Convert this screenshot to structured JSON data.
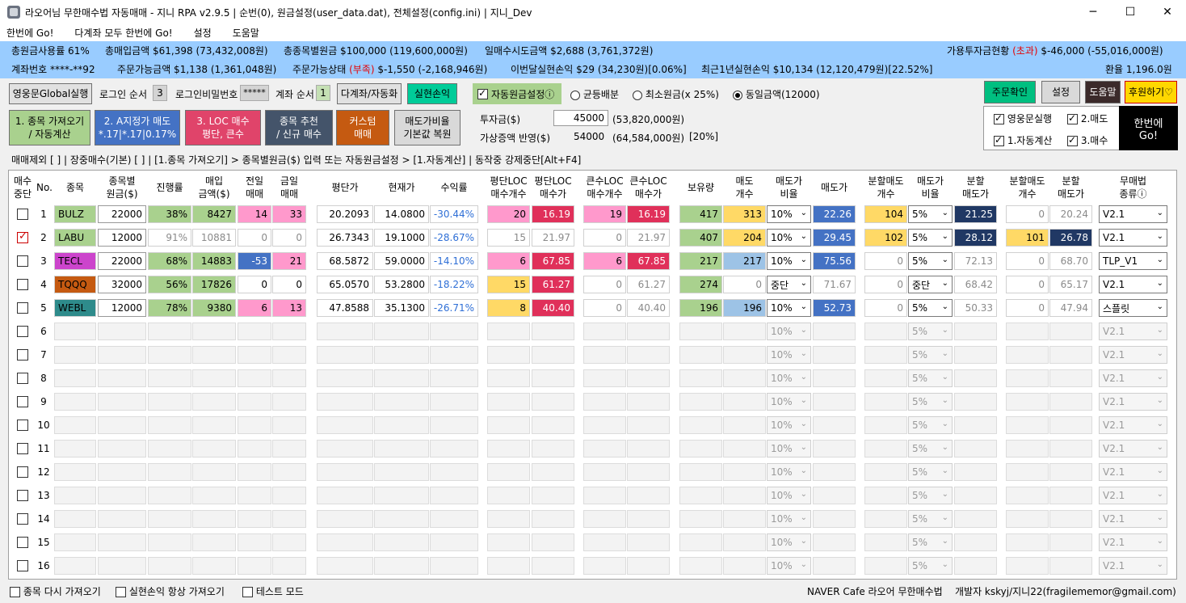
{
  "title": "라오어님 무한매수법 자동매매 - 지니 RPA v2.9.5    | 순번(0),  원금설정(user_data.dat),  전체설정(config.ini) | 지니_Dev",
  "window": {
    "minimize": "─",
    "maximize": "☐",
    "close": "✕"
  },
  "menu": [
    "한번에 Go!",
    "다계좌 모두 한번에 Go!",
    "설정",
    "도움말"
  ],
  "info1": {
    "a": "총원금사용률 61%",
    "b": "총매입금액 $61,398 (73,432,008원)",
    "c": "총종목별원금 $100,000 (119,600,000원)",
    "d": "일매수시도금액 $2,688 (3,761,372원)",
    "e1": "가용투자금현황 ",
    "e2": "(초과)",
    "e3": " $-46,000 (-55,016,000원)"
  },
  "info2": {
    "a": "계좌번호 ****-**92",
    "b": "주문가능금액 $1,138 (1,361,048원)",
    "c1": "주문가능상태 ",
    "c2": "(부족)",
    "c3": " $-1,550 (-2,168,946원)",
    "d": "이번달실현손익 $29 (34,230원)[0.06%]",
    "e": "최근1년실현손익 $10,134 (12,120,479원)[22.52%]",
    "f": "환율 1,196.0원"
  },
  "controls": {
    "global_btn": "영웅문Global실행",
    "login_order_label": "로그인 순서",
    "login_order": "3",
    "login_pw_label": "로그인비밀번호",
    "login_pw": "*****",
    "acct_order_label": "계좌 순서",
    "acct_order": "1",
    "multi_btn": "다계좌/자동화",
    "realized_btn": "실현손익",
    "auto_principal": "자동원금설정ⓘ",
    "opt1": "균등배분",
    "opt2": "최소원금(x 25%)",
    "opt3": "동일금액(12000)",
    "order_check": "주문확인",
    "settings": "설정",
    "help": "도움말",
    "donate": "후원하기♡"
  },
  "actions": {
    "b1a": "1. 종목 가져오기",
    "b1b": "/ 자동계산",
    "b2a": "2. A지정가 매도",
    "b2b": "*.17|*.17|0.17%",
    "b3a": "3. LOC 매수",
    "b3b": "평단, 큰수",
    "b4a": "종목 추천",
    "b4b": "/ 신규 매수",
    "b5a": "커스텀",
    "b5b": "매매",
    "b6a": "매도가비율",
    "b6b": "기본값 복원"
  },
  "invest": {
    "label1": "투자금($)",
    "value1": "45000",
    "won1": "(53,820,000원)",
    "label2": "가상증액 반영($)",
    "value2": "54000",
    "won2": "(64,584,000원)",
    "pct": "[20%]"
  },
  "go": {
    "c1": "영웅문실행",
    "c2": "2.매도",
    "c3": "1.자동계산",
    "c4": "3.매수",
    "go1": "한번에",
    "go2": "Go!"
  },
  "status": "매매제외 [  ] | 장중매수(기본) [  ] | [1.종목 가져오기] > 종목별원금($) 입력 또는 자동원금설정 > [1.자동계산] | 동작중 강제중단[Alt+F4]",
  "headers": [
    "매수\n중단",
    "No.",
    "종목",
    "종목별\n원금($)",
    "진행률",
    "매입\n금액($)",
    "전일\n매매",
    "금일\n매매",
    "평단가",
    "현재가",
    "수익률",
    "평단LOC\n매수개수",
    "평단LOC\n매수가",
    "큰수LOC\n매수개수",
    "큰수LOC\n매수가",
    "보유량",
    "매도\n개수",
    "매도가\n비율",
    "매도가",
    "분할매도\n개수",
    "매도가\n비율",
    "분할\n매도가",
    "분할매도\n개수",
    "분할\n매도가",
    "무매법\n종류ⓘ"
  ],
  "rows": [
    {
      "no": "1",
      "stop": false,
      "ticker": "BULZ",
      "tcolor": "#a9d18e",
      "principal": "22000",
      "progress": "38%",
      "buy": "8427",
      "prev": "14",
      "today": "33",
      "avg": "20.2093",
      "cur": "14.0800",
      "ret": "-30.44%",
      "avgQty": "20",
      "avgPrice": "16.19",
      "bigQty": "19",
      "bigPrice": "16.19",
      "hold": "417",
      "sellQty": "313",
      "ratio1": "10%",
      "sellPrice": "22.26",
      "splitQty1": "104",
      "ratio2": "5%",
      "splitPrice1": "21.25",
      "splitQty2": "0",
      "splitPrice2": "20.24",
      "method": "V2.1"
    },
    {
      "no": "2",
      "stop": true,
      "ticker": "LABU",
      "tcolor": "#a9d18e",
      "principal": "12000",
      "progress": "91%",
      "buy": "10881",
      "prev": "0",
      "today": "0",
      "avg": "26.7343",
      "cur": "19.1000",
      "ret": "-28.67%",
      "avgQty": "15",
      "avgPrice": "21.97",
      "bigQty": "0",
      "bigPrice": "21.97",
      "hold": "407",
      "sellQty": "204",
      "ratio1": "10%",
      "sellPrice": "29.45",
      "splitQty1": "102",
      "ratio2": "5%",
      "splitPrice1": "28.12",
      "splitQty2": "101",
      "splitPrice2": "26.78",
      "method": "V2.1"
    },
    {
      "no": "3",
      "stop": false,
      "ticker": "TECL",
      "tcolor": "#cc44cc",
      "principal": "22000",
      "progress": "68%",
      "buy": "14883",
      "prev": "-53",
      "today": "21",
      "avg": "68.5872",
      "cur": "59.0000",
      "ret": "-14.10%",
      "avgQty": "6",
      "avgPrice": "67.85",
      "bigQty": "6",
      "bigPrice": "67.85",
      "hold": "217",
      "sellQty": "217",
      "ratio1": "10%",
      "sellPrice": "75.56",
      "splitQty1": "0",
      "ratio2": "5%",
      "splitPrice1": "72.13",
      "splitQty2": "0",
      "splitPrice2": "68.70",
      "method": "TLP_V1"
    },
    {
      "no": "4",
      "stop": false,
      "ticker": "TQQQ",
      "tcolor": "#c55a11",
      "principal": "32000",
      "progress": "56%",
      "buy": "17826",
      "prev": "0",
      "today": "0",
      "avg": "65.0570",
      "cur": "53.2800",
      "ret": "-18.22%",
      "avgQty": "15",
      "avgPrice": "61.27",
      "bigQty": "0",
      "bigPrice": "61.27",
      "hold": "274",
      "sellQty": "0",
      "ratio1": "중단",
      "sellPrice": "71.67",
      "splitQty1": "0",
      "ratio2": "중단",
      "splitPrice1": "68.42",
      "splitQty2": "0",
      "splitPrice2": "65.17",
      "method": "V2.1"
    },
    {
      "no": "5",
      "stop": false,
      "ticker": "WEBL",
      "tcolor": "#2e8b8b",
      "principal": "12000",
      "progress": "78%",
      "buy": "9380",
      "prev": "6",
      "today": "13",
      "avg": "47.8588",
      "cur": "35.1300",
      "ret": "-26.71%",
      "avgQty": "8",
      "avgPrice": "40.40",
      "bigQty": "0",
      "bigPrice": "40.40",
      "hold": "196",
      "sellQty": "196",
      "ratio1": "10%",
      "sellPrice": "52.73",
      "splitQty1": "0",
      "ratio2": "5%",
      "splitPrice1": "50.33",
      "splitQty2": "0",
      "splitPrice2": "47.94",
      "method": "스플릿"
    }
  ],
  "empty_rows": [
    "6",
    "7",
    "8",
    "9",
    "10",
    "11",
    "12",
    "13",
    "14",
    "15",
    "16"
  ],
  "empty_defaults": {
    "ratio1": "10%",
    "ratio2": "5%",
    "method": "V2.1"
  },
  "footer": {
    "c1": "종목 다시 가져오기",
    "c2": "실현손익 항상 가져오기",
    "c3": "테스트 모드",
    "cafe": "NAVER Cafe 라오어 무한매수법",
    "dev": "개발자 kskyj/지니22(fragilememor@gmail.com)"
  }
}
